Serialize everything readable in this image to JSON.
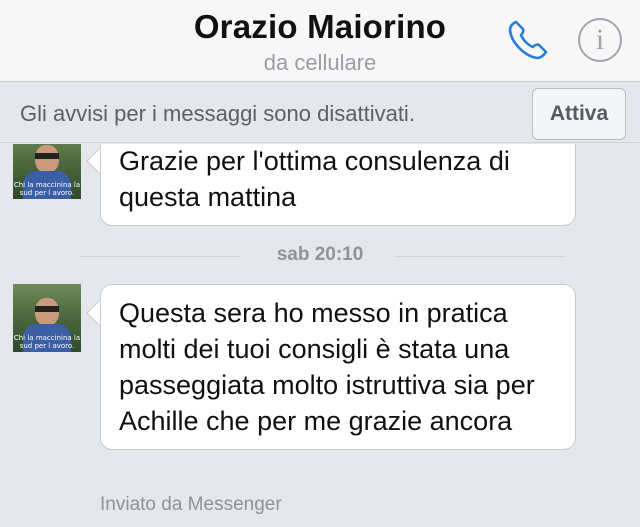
{
  "header": {
    "contact_name": "Orazio Maiorino",
    "contact_subtitle": "da cellulare",
    "call_icon": "phone-icon",
    "info_icon": "info-icon",
    "info_glyph": "i",
    "accent_color": "#2a7fd4"
  },
  "notice": {
    "text": "Gli avvisi per i messaggi sono disattivati.",
    "button_label": "Attiva"
  },
  "messages": [
    {
      "text": "Grazie per l'ottima consulenza di questa mattina"
    },
    {
      "text": "Questa sera ho messo in pratica molti dei tuoi consigli è stata una passeggiata molto istruttiva sia per Achille che per me grazie ancora"
    }
  ],
  "timestamp": "sab 20:10",
  "avatar_caption": "Chi la maccinina la sud per l avoro.",
  "footer_note": "Inviato da Messenger"
}
